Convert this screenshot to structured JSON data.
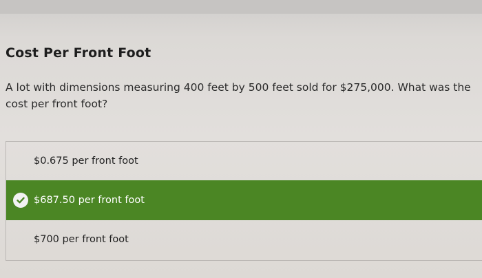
{
  "quiz": {
    "title": "Cost Per Front Foot",
    "question": "A lot with dimensions measuring 400 feet by 500 feet sold for $275,000. What was the cost per front foot?",
    "options": [
      {
        "label": "$0.675 per front foot",
        "selected": false
      },
      {
        "label": "$687.50 per front foot",
        "selected": true
      },
      {
        "label": "$700 per front foot",
        "selected": false
      }
    ]
  },
  "colors": {
    "selected_background": "#4b8624",
    "selected_text": "#ffffff",
    "check_icon": "check-circle-icon"
  }
}
